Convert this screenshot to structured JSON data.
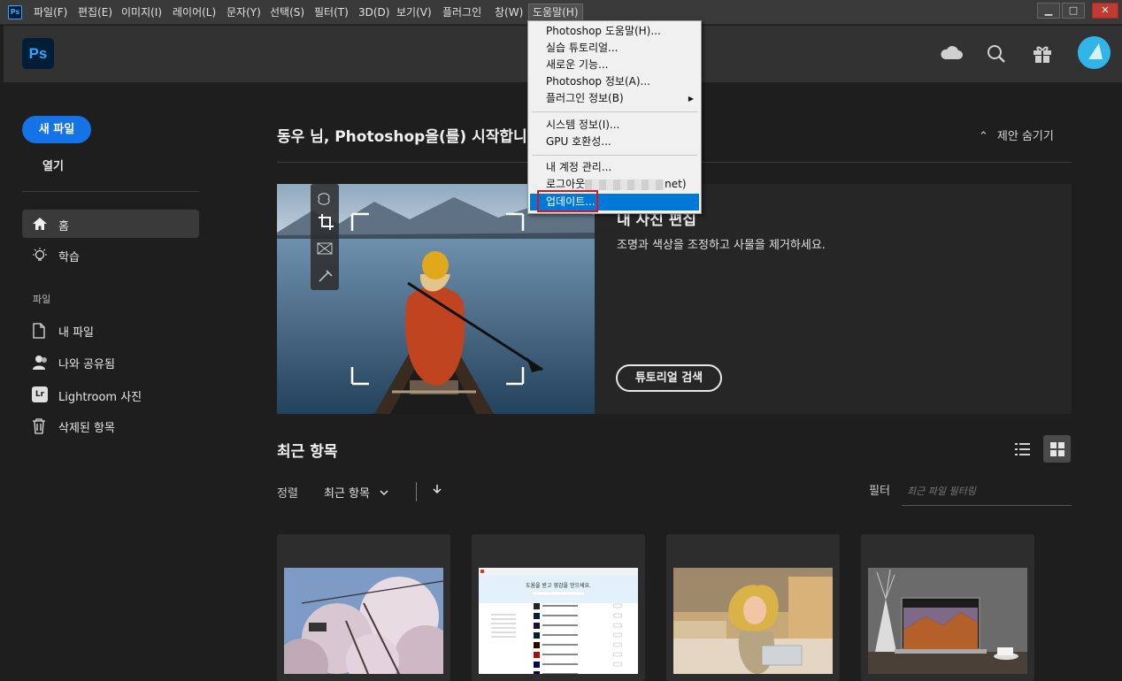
{
  "menubar": {
    "items": [
      "파일(F)",
      "편집(E)",
      "이미지(I)",
      "레이어(L)",
      "문자(Y)",
      "선택(S)",
      "필터(T)",
      "3D(D)",
      "보기(V)",
      "플러그인",
      "창(W)",
      "도움말(H)"
    ],
    "minimize": "▁",
    "maximize": "□",
    "close": "✕"
  },
  "appbar": {
    "logo": "Ps",
    "mini_logo": "Ps"
  },
  "sidebar": {
    "new_file": "새 파일",
    "open": "열기",
    "home": "홈",
    "learn": "학습",
    "section_files": "파일",
    "my_files": "내 파일",
    "shared": "나와 공유됨",
    "lightroom": "Lightroom 사진",
    "lr_badge": "Lr",
    "deleted": "삭제된 항목"
  },
  "main": {
    "welcome": "동우 님, Photoshop을(를) 시작합니다",
    "hide_suggestions": "제안 숨기기",
    "hero_title": "내 사진 편집",
    "hero_desc": "조명과 색상을 조정하고 사물을 제거하세요.",
    "tutorial_button": "튜토리얼 검색",
    "recent_title": "최근 항목",
    "sort_label": "정렬",
    "sort_value": "최근 항목",
    "filter_label": "필터",
    "filter_placeholder": "최근 파일 필터링",
    "thumb2_heading": "도움을 받고 영감을 얻으세요."
  },
  "help_menu": {
    "items": [
      "Photoshop 도움말(H)...",
      "실습 튜토리얼...",
      "새로운 기능...",
      "Photoshop 정보(A)...",
      "플러그인 정보(B)",
      "시스템 정보(I)...",
      "GPU 호환성...",
      "내 계정 관리...",
      "로그아웃",
      "업데이트..."
    ],
    "logout_suffix": "net)"
  }
}
